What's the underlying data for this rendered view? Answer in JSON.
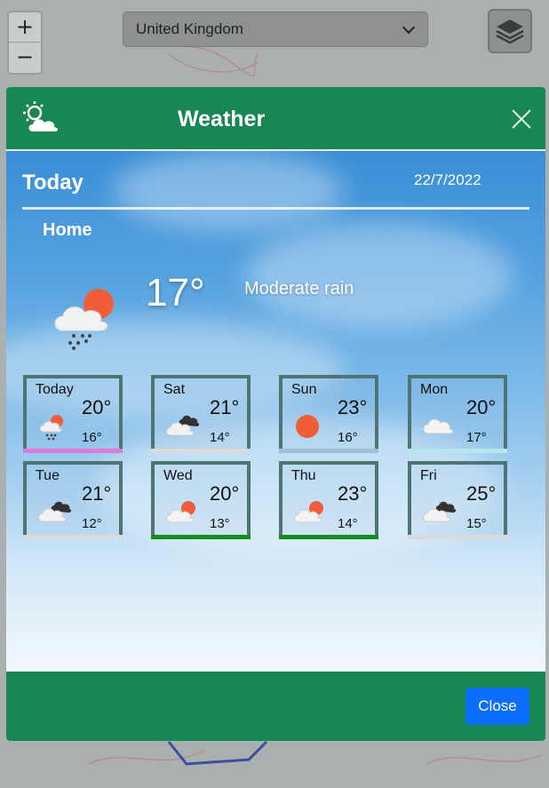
{
  "map": {
    "zoom_in": "+",
    "zoom_out": "−",
    "country": "United Kingdom"
  },
  "modal": {
    "title": "Weather",
    "today_label": "Today",
    "date": "22/7/2022",
    "place": "Home",
    "current": {
      "temp": "17°",
      "description": "Moderate rain",
      "icon": "rain-cloud-sun-icon"
    },
    "days": [
      {
        "name": "Today",
        "hi": "20°",
        "lo": "16°",
        "icon": "rain-cloud-sun-icon",
        "bar": "#e07ad8"
      },
      {
        "name": "Sat",
        "hi": "21°",
        "lo": "14°",
        "icon": "dark-cloud-icon",
        "bar": "#d9dadd"
      },
      {
        "name": "Sun",
        "hi": "23°",
        "lo": "16°",
        "icon": "sun-icon",
        "bar": "#9fc2d3"
      },
      {
        "name": "Mon",
        "hi": "20°",
        "lo": "17°",
        "icon": "cloud-icon",
        "bar": "#b7e6ea"
      },
      {
        "name": "Tue",
        "hi": "21°",
        "lo": "12°",
        "icon": "dark-cloud-icon",
        "bar": "#dadbdd"
      },
      {
        "name": "Wed",
        "hi": "20°",
        "lo": "13°",
        "icon": "cloud-sun-icon",
        "bar": "#118d19"
      },
      {
        "name": "Thu",
        "hi": "23°",
        "lo": "14°",
        "icon": "cloud-sun-icon",
        "bar": "#118d19"
      },
      {
        "name": "Fri",
        "hi": "25°",
        "lo": "15°",
        "icon": "dark-cloud-icon",
        "bar": "#d8dadd"
      }
    ],
    "close_label": "Close"
  },
  "colors": {
    "header": "#198754",
    "button": "#0d6efd",
    "card_border": "#4f7474"
  }
}
